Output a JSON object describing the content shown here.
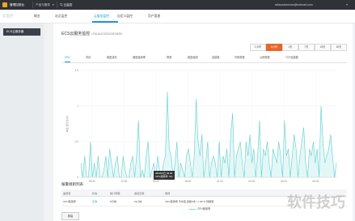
{
  "topbar": {
    "home": "管理控制台",
    "products": "产品与服务",
    "cloud_monitor": "云监控",
    "account": "alicloudservice@hotmail.com"
  },
  "subnav": {
    "brand": "云监控",
    "items": [
      "概览",
      "站点监控",
      "云服务监控",
      "自定义监控",
      "用户管理"
    ],
    "active_index": 2
  },
  "sidebar": {
    "selected": "ECS云服务器"
  },
  "panel": {
    "title": "ECS云服务监控",
    "instance_id": "i-FNUA4V3Z9VD5D9ER0"
  },
  "ranges": [
    "1小时",
    "6小时",
    "1天",
    "7天",
    "15天",
    "30天"
  ],
  "range_active": 1,
  "metric_tabs": [
    "CPU",
    "内存",
    "磁盘读写",
    "硬盘使用率",
    "带宽",
    "磁盘使用",
    "连接数",
    "外网带宽",
    "公网带宽",
    "TCP连接数"
  ],
  "metric_active": 0,
  "tooltip": {
    "time": "08/06/4日 09:00",
    "value": "CPU使用率: 0%"
  },
  "chart_data": {
    "type": "area",
    "ylabel": "单位:百分比(%)",
    "ylim": [
      0,
      1.5
    ],
    "yticks": [
      "0",
      "0.5",
      "1",
      "1.5"
    ],
    "xticks": [
      "09:00",
      "12:00",
      "15:00",
      "18:00",
      "21:00",
      "00:00",
      "03:00",
      "06:00"
    ],
    "series": [
      {
        "name": "CPU使用率",
        "values": [
          0.2,
          0,
          0.3,
          0,
          0,
          0.5,
          0,
          0.2,
          0,
          0.3,
          0,
          0,
          0.1,
          0.3,
          0,
          0.4,
          0.2,
          0,
          0.2,
          0.3,
          0,
          0,
          0.3,
          0.1,
          0,
          0,
          0.2,
          0.3,
          0,
          0.3,
          0.8,
          0,
          0.1,
          0,
          0.3,
          0.5,
          0,
          0.1,
          0.2,
          0,
          0.3,
          0.1,
          0,
          0.2,
          0.3,
          1.2,
          0.4,
          0.3,
          0,
          0.2,
          0.5,
          0,
          0.2,
          0.1,
          0,
          0.3,
          0.4,
          0.2,
          0,
          0.3,
          1.1,
          0.5,
          0.3,
          0.6,
          0,
          0.2,
          0.5,
          0,
          0.2,
          0.3,
          0.2,
          0,
          0.5,
          0,
          0.3,
          0.2,
          0.4,
          0,
          0.6,
          0.9,
          0,
          0.3,
          0.4,
          0.5,
          0.2,
          0,
          0.5,
          0.3,
          0.6,
          0.2,
          0.4,
          0,
          0.3,
          0.8,
          0,
          0.4,
          0.3,
          0.5,
          0.2,
          0,
          0.4,
          0.3,
          0.2,
          0.5,
          0.3,
          0,
          0.8,
          0.3,
          0.4,
          0,
          0.3,
          0.6,
          0.4,
          0,
          0.3,
          0.5,
          0.7,
          0.2,
          0,
          0.4,
          0.3,
          0.5,
          0.2,
          0.4,
          0,
          1.0,
          0.5,
          0.2,
          0.3,
          0.4,
          0.6,
          0.3,
          0,
          0.2
        ]
      }
    ],
    "legend": "CPU使用率",
    "grid": true
  },
  "alarm": {
    "heading": "报警规则列表",
    "columns": [
      "监控项",
      "状态",
      "统计周期",
      "通道沉默",
      "规则"
    ],
    "row": [
      "CPU使用率",
      "正常",
      "5分钟",
      "24小时",
      "CPU使用率 平均值 连续3次 >= 80 % 则报警"
    ],
    "add_button": "新建"
  },
  "watermark": "软件技巧"
}
